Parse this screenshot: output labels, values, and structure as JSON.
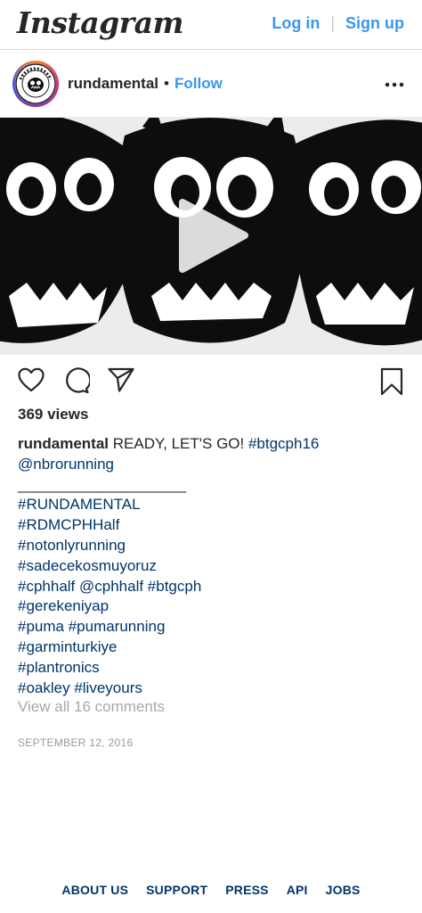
{
  "header": {
    "logo_text": "Instagram",
    "login_label": "Log in",
    "separator": "|",
    "signup_label": "Sign up"
  },
  "post": {
    "username": "rundamental",
    "dot": "•",
    "follow_label": "Follow",
    "more_icon": "more-horizontal-icon",
    "media_type": "video",
    "play_icon": "play-icon",
    "actions": {
      "like_icon": "heart-icon",
      "comment_icon": "comment-icon",
      "share_icon": "paper-plane-icon",
      "save_icon": "bookmark-icon"
    },
    "views": "369 views",
    "caption": {
      "user": "rundamental",
      "text": " READY, LET'S GO! ",
      "lines": [
        {
          "tag1": "#btgcph16"
        },
        {
          "mention": "@nbrorunning"
        },
        {
          "text": "____________________"
        },
        {
          "tag": "#RUNDAMENTAL"
        },
        {
          "tag": "#RDMCPHHalf"
        },
        {
          "tag": "#notonlyrunning"
        },
        {
          "tag": "#sadecekosmuyoruz"
        },
        {
          "tag": "#cphhalf @cphhalf #btgcph"
        },
        {
          "tag": "#gerekeniyap"
        },
        {
          "tag": "#puma #pumarunning"
        },
        {
          "tag": "#garminturkiye"
        },
        {
          "tag": "#plantronics"
        },
        {
          "tag": "#oakley #liveyours"
        }
      ]
    },
    "view_all_comments": "View all 16 comments",
    "date": "SEPTEMBER 12, 2016"
  },
  "footer": {
    "links": [
      "ABOUT US",
      "SUPPORT",
      "PRESS",
      "API",
      "JOBS"
    ]
  },
  "colors": {
    "link_blue": "#3897f0",
    "hashtag_blue": "#003569",
    "text": "#262626",
    "muted": "#a8a8a8"
  }
}
